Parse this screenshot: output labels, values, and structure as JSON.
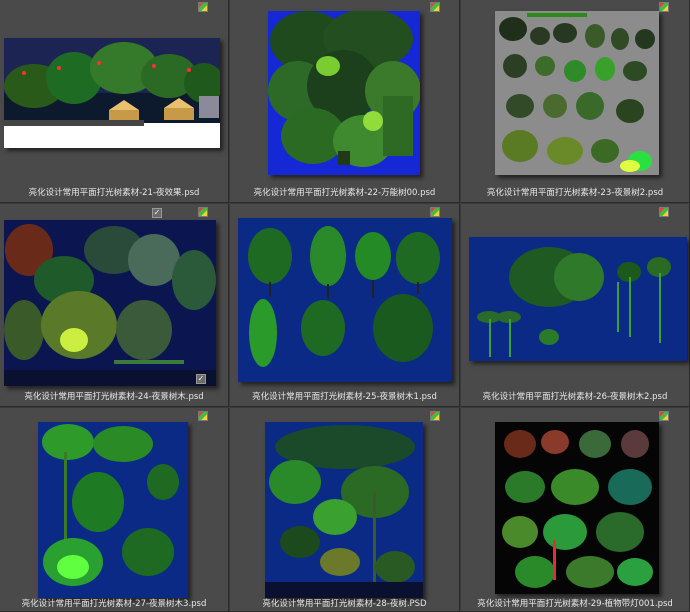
{
  "files": [
    {
      "name": "亮化设计常用平面打光树素材-21-夜效果.psd"
    },
    {
      "name": "亮化设计常用平面打光树素材-22-万能树00.psd"
    },
    {
      "name": "亮化设计常用平面打光树素材-23-夜景树2.psd"
    },
    {
      "name": "亮化设计常用平面打光树素材-24-夜景树木.psd"
    },
    {
      "name": "亮化设计常用平面打光树素材-25-夜景树木1.psd"
    },
    {
      "name": "亮化设计常用平面打光树素材-26-夜景树木2.psd"
    },
    {
      "name": "亮化设计常用平面打光树素材-27-夜景树木3.psd"
    },
    {
      "name": "亮化设计常用平面打光树素材-28-夜树.PSD"
    },
    {
      "name": "亮化设计常用平面打光树素材-29-植物带灯001.psd"
    }
  ],
  "icons": {
    "file_badge": "photoshop-file-icon",
    "selection_check": "checkbox-icon"
  },
  "colors": {
    "background": "#3a3a3a",
    "cell": "#4a4a4a",
    "night_blue": "#0a2a7a",
    "glow_green": "#3cff3c"
  }
}
